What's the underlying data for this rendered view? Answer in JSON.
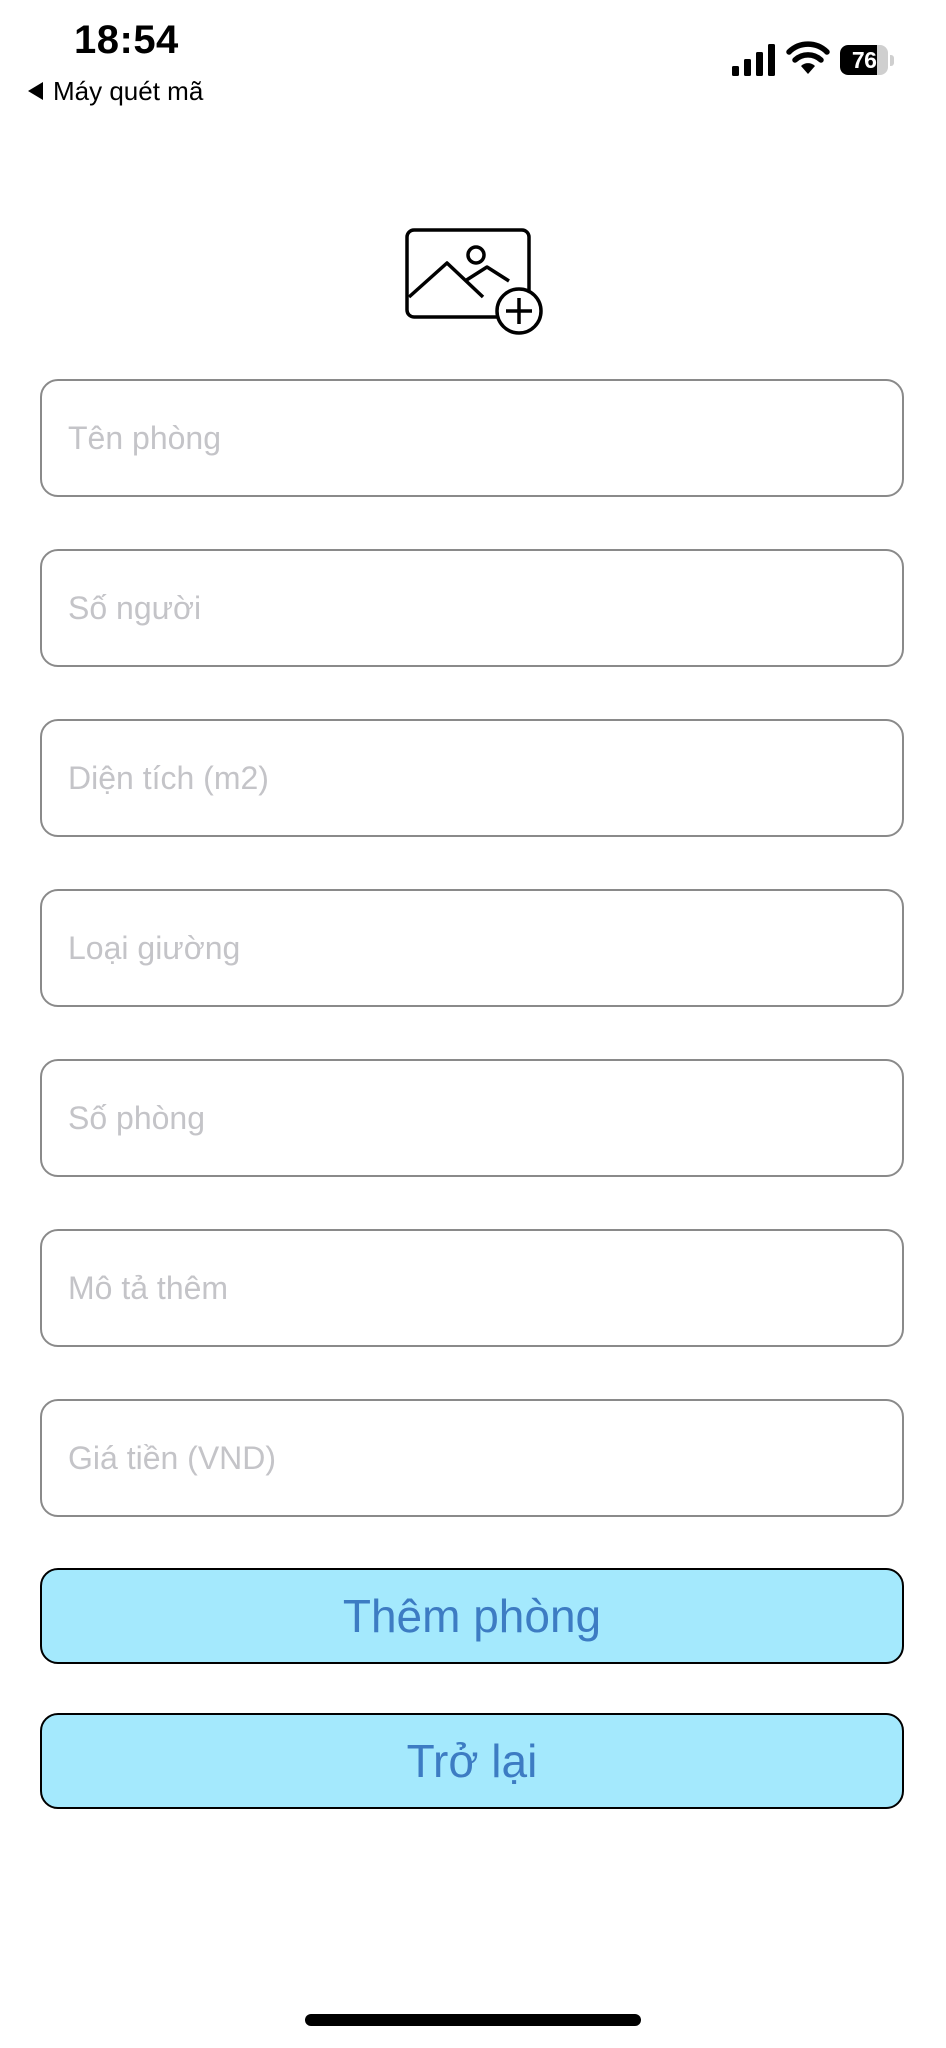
{
  "status_bar": {
    "time": "18:54",
    "back_app_label": "Máy quét mã",
    "battery_level": "76",
    "battery_fraction": 0.76,
    "signal_icon": "cellular-signal-icon",
    "wifi_icon": "wifi-icon"
  },
  "image_picker": {
    "icon": "add-photo-icon"
  },
  "form": {
    "fields": [
      {
        "placeholder": "Tên phòng",
        "value": ""
      },
      {
        "placeholder": "Số người",
        "value": ""
      },
      {
        "placeholder": "Diện tích (m2)",
        "value": ""
      },
      {
        "placeholder": "Loại giường",
        "value": ""
      },
      {
        "placeholder": "Số phòng",
        "value": ""
      },
      {
        "placeholder": "Mô tả thêm",
        "value": ""
      },
      {
        "placeholder": "Giá tiền (VND)",
        "value": ""
      }
    ],
    "add_button_label": "Thêm phòng",
    "back_button_label": "Trở lại"
  },
  "colors": {
    "button_background": "#a4e9fd",
    "button_text": "#3d7cc3",
    "field_border": "#8a8a8a",
    "placeholder": "#c4c4c8"
  }
}
